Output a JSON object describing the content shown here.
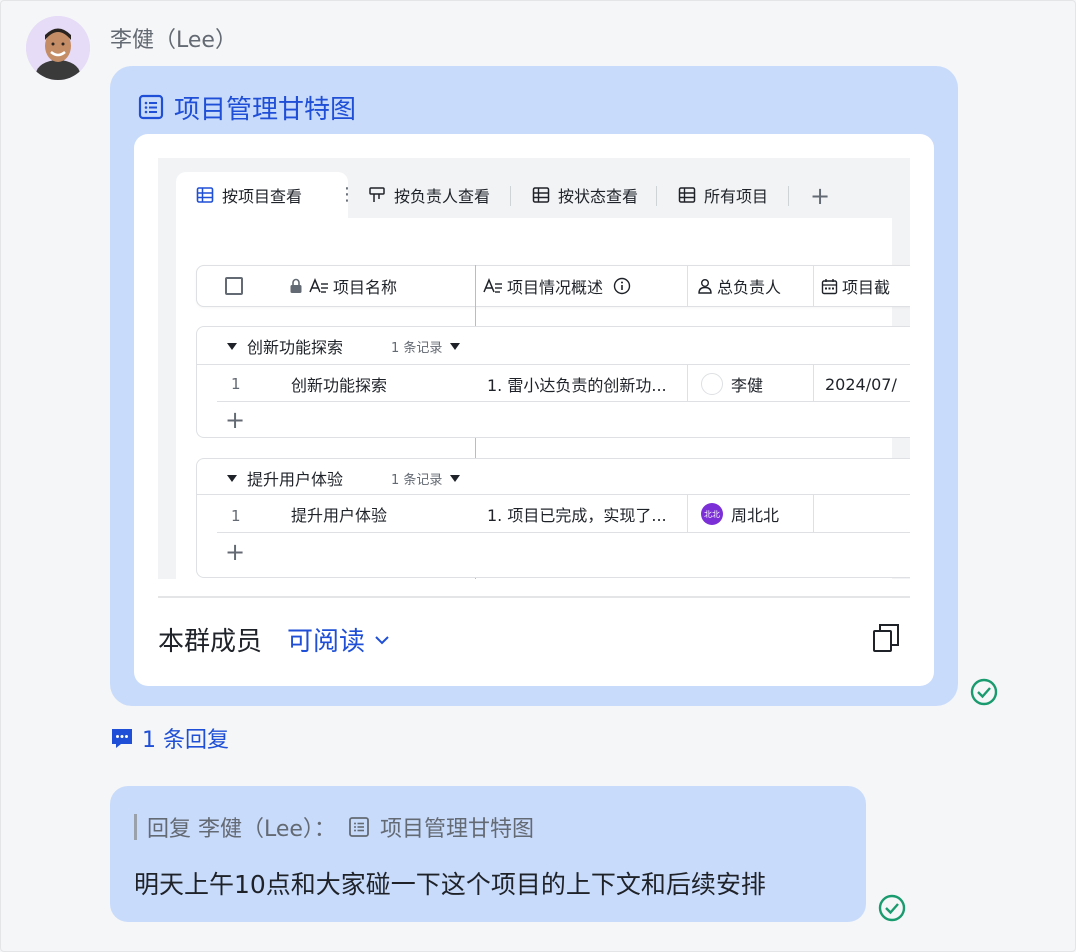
{
  "sender": {
    "name": "李健（Lee）"
  },
  "doc_card": {
    "title": "项目管理甘特图",
    "tabs": [
      {
        "label": "按项目查看",
        "icon": "grid-icon",
        "active": true
      },
      {
        "label": "按负责人查看",
        "icon": "kanban-icon"
      },
      {
        "label": "按状态查看",
        "icon": "grid-icon"
      },
      {
        "label": "所有项目",
        "icon": "grid-icon"
      }
    ],
    "add_tab_label": "+",
    "columns": [
      {
        "label": "项目名称",
        "icon": "lock-text-icon"
      },
      {
        "label": "项目情况概述",
        "icon": "text-field-icon"
      },
      {
        "label": "总负责人",
        "icon": "person-icon"
      },
      {
        "label": "项目截",
        "icon": "calendar-icon"
      }
    ],
    "groups": [
      {
        "name": "创新功能探索",
        "count": "1 条记录",
        "rows": [
          {
            "num": "1",
            "name": "创新功能探索",
            "summary": "1. 雷小达负责的创新功...",
            "owner": "李健",
            "owner_avatar": "",
            "date": "2024/07/"
          }
        ]
      },
      {
        "name": "提升用户体验",
        "count": "1 条记录",
        "rows": [
          {
            "num": "1",
            "name": "提升用户体验",
            "summary": "1. 项目已完成，实现了...",
            "owner": "周北北",
            "owner_avatar": "北北",
            "date": ""
          }
        ]
      }
    ],
    "permission": {
      "label": "本群成员",
      "value": "可阅读"
    }
  },
  "reply_link": "1 条回复",
  "reply_message": {
    "quote_prefix": "回复 李健（Lee）：",
    "quote_doc": "项目管理甘特图",
    "text": "明天上午10点和大家碰一下这个项目的上下文和后续安排"
  },
  "colors": {
    "accent": "#1f4fd6",
    "bubble": "#c9dbfb",
    "read_check": "#1a9b6f"
  }
}
